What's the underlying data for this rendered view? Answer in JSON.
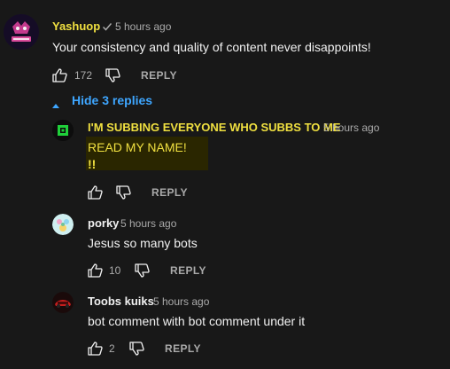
{
  "colors": {
    "background": "#181818",
    "text": "#f1f1f1",
    "muted": "#aaaaaa",
    "link": "#3ea6ff",
    "highlight_author": "#f0e040"
  },
  "comment": {
    "author": "Yashuop",
    "verified_icon": "checkmark-icon",
    "time": "5 hours ago",
    "text": "Your consistency and quality of content never disappoints!",
    "likes": "172",
    "reply_label": "REPLY"
  },
  "hide_replies_label": "Hide 3 replies",
  "replies": [
    {
      "author": "I'M SUBBING EVERYONE WHO SUBBS TO ME",
      "time": "5 hours ago",
      "text_lines": [
        "READ MY NAME!",
        "!!"
      ],
      "likes": "",
      "reply_label": "REPLY"
    },
    {
      "author": "porky",
      "time": "5 hours ago",
      "text": "Jesus so many bots",
      "likes": "10",
      "reply_label": "REPLY"
    },
    {
      "author": "Toobs kuiks",
      "time": "5 hours ago",
      "text": "bot comment with bot comment under it",
      "likes": "2",
      "reply_label": "REPLY"
    }
  ]
}
